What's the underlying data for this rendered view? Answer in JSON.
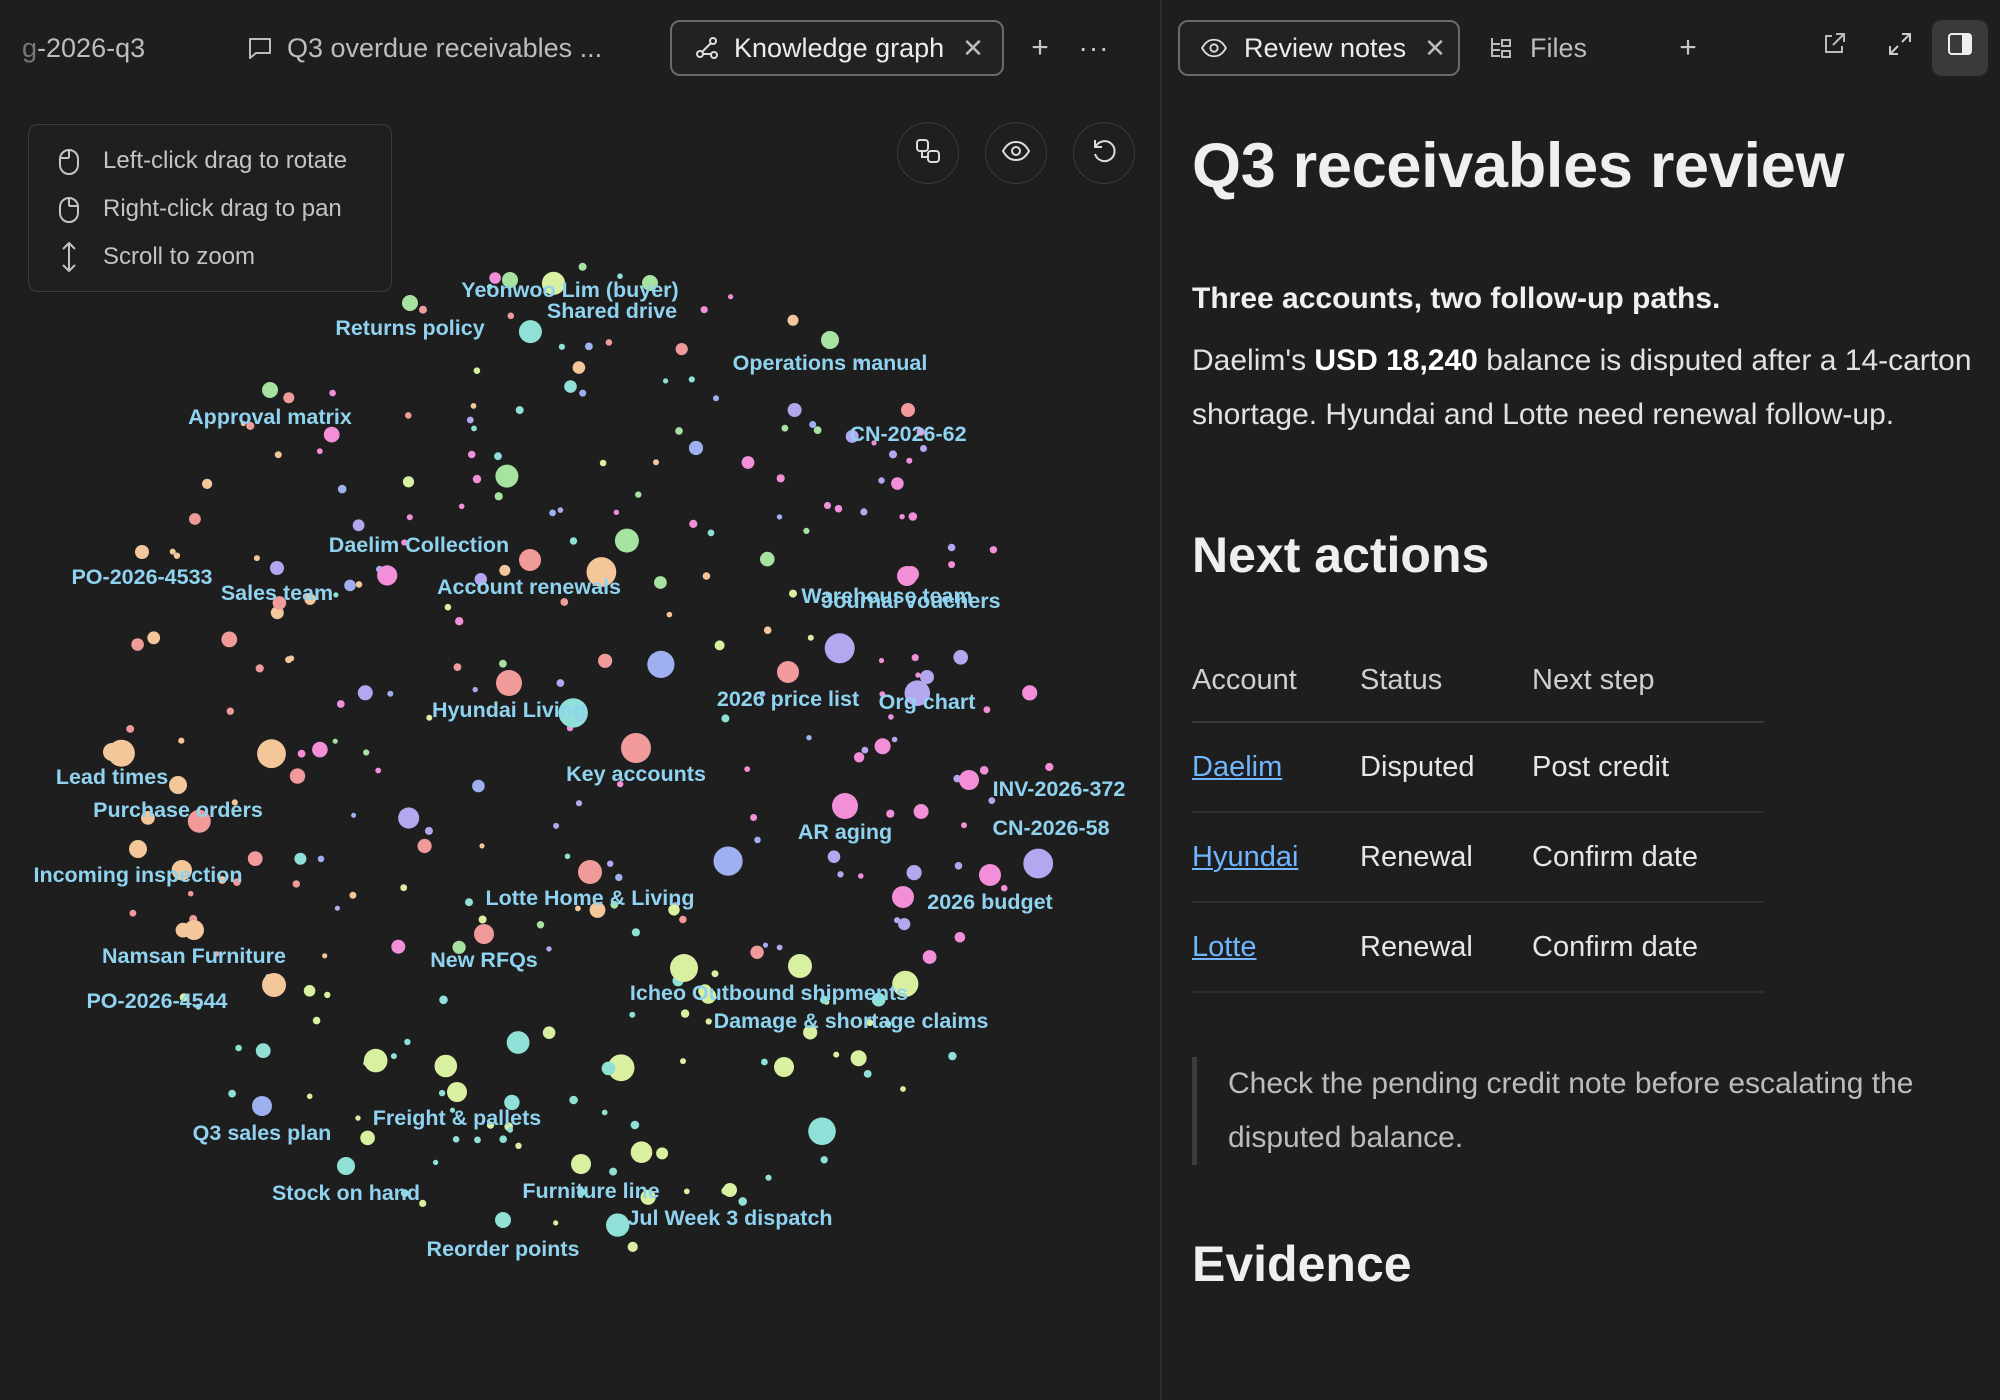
{
  "left_tabs": {
    "tab1_label": "-2026-q3",
    "tab1_prefix": "g",
    "tab2_label": "Q3 overdue receivables ...",
    "tab3_label": "Knowledge graph"
  },
  "help": {
    "rotate": "Left-click drag to rotate",
    "pan": "Right-click drag to pan",
    "zoom": "Scroll to zoom"
  },
  "graph_labels": [
    {
      "id": "yeonwoo",
      "text": "Yeonwoo Lim (buyer)"
    },
    {
      "id": "shared",
      "text": "Shared drive"
    },
    {
      "id": "returns",
      "text": "Returns policy"
    },
    {
      "id": "ops",
      "text": "Operations manual"
    },
    {
      "id": "approval",
      "text": "Approval matrix"
    },
    {
      "id": "cn62",
      "text": "CN-2026-62"
    },
    {
      "id": "daelim",
      "text": "Daelim Collection"
    },
    {
      "id": "po4533",
      "text": "PO-2026-4533"
    },
    {
      "id": "sales",
      "text": "Sales team"
    },
    {
      "id": "renewals",
      "text": "Account renewals"
    },
    {
      "id": "journal",
      "text": "Journal vouchers"
    },
    {
      "id": "warehouse",
      "text": "Warehouse team"
    },
    {
      "id": "price",
      "text": "2026 price list"
    },
    {
      "id": "org",
      "text": "Org chart"
    },
    {
      "id": "hyundai",
      "text": "Hyundai Living"
    },
    {
      "id": "lead",
      "text": "Lead times"
    },
    {
      "id": "keyacc",
      "text": "Key accounts"
    },
    {
      "id": "inv372",
      "text": "INV-2026-372"
    },
    {
      "id": "purchase",
      "text": "Purchase orders"
    },
    {
      "id": "ar",
      "text": "AR aging"
    },
    {
      "id": "cn58",
      "text": "CN-2026-58"
    },
    {
      "id": "incoming",
      "text": "Incoming inspection"
    },
    {
      "id": "lotte",
      "text": "Lotte Home & Living"
    },
    {
      "id": "budget",
      "text": "2026 budget"
    },
    {
      "id": "namsan",
      "text": "Namsan Furniture"
    },
    {
      "id": "rfqs",
      "text": "New RFQs"
    },
    {
      "id": "icheon",
      "text": "Icheo"
    },
    {
      "id": "outbound",
      "text": "Outbound shipments"
    },
    {
      "id": "po4544",
      "text": "PO-2026-4544"
    },
    {
      "id": "damage",
      "text": "Damage & shortage claims"
    },
    {
      "id": "freight",
      "text": "Freight & pallets"
    },
    {
      "id": "q3plan",
      "text": "Q3 sales plan"
    },
    {
      "id": "stock",
      "text": "Stock on hand"
    },
    {
      "id": "furniture",
      "text": "Furniture line"
    },
    {
      "id": "jul",
      "text": "Jul Week 3 dispatch"
    },
    {
      "id": "reorder",
      "text": "Reorder points"
    }
  ],
  "right_tabs": {
    "review_label": "Review notes",
    "files_label": "Files"
  },
  "note": {
    "title": "Q3 receivables review",
    "summary_heading": "Three accounts, two follow-up paths.",
    "summary_pre": "Daelim's ",
    "summary_amount": "USD 18,240",
    "summary_post": " balance is disputed after a 14-carton shortage. Hyundai and Lotte need renewal follow-up.",
    "next_heading": "Next actions",
    "table_headers": [
      "Account",
      "Status",
      "Next step"
    ],
    "rows": [
      {
        "account": "Daelim",
        "status": "Disputed",
        "step": "Post credit"
      },
      {
        "account": "Hyundai",
        "status": "Renewal",
        "step": "Confirm date"
      },
      {
        "account": "Lotte",
        "status": "Renewal",
        "step": "Confirm date"
      }
    ],
    "callout": "Check the pending credit note before escalating the disputed balance.",
    "evidence_heading": "Evidence"
  },
  "colors": {
    "background": "#1e1e1e",
    "label": "#8fd3f0",
    "link": "#6fb6ff",
    "node_green": "#a6e3a1",
    "node_pink": "#f09a9a",
    "node_purple": "#b4a7f0",
    "node_orange": "#f4c79a",
    "node_magenta": "#f28fd8",
    "node_teal": "#8fe0d6",
    "node_lime": "#d8f0a0",
    "node_blue": "#9fb0f0"
  },
  "icons": [
    "chat-icon",
    "graph-icon",
    "close-icon",
    "plus-icon",
    "more-icon",
    "eye-icon",
    "files-icon",
    "open-external-icon",
    "expand-icon",
    "sidebar-icon",
    "mouse-left-icon",
    "mouse-right-icon",
    "scroll-icon",
    "copy-icon",
    "reset-icon"
  ]
}
